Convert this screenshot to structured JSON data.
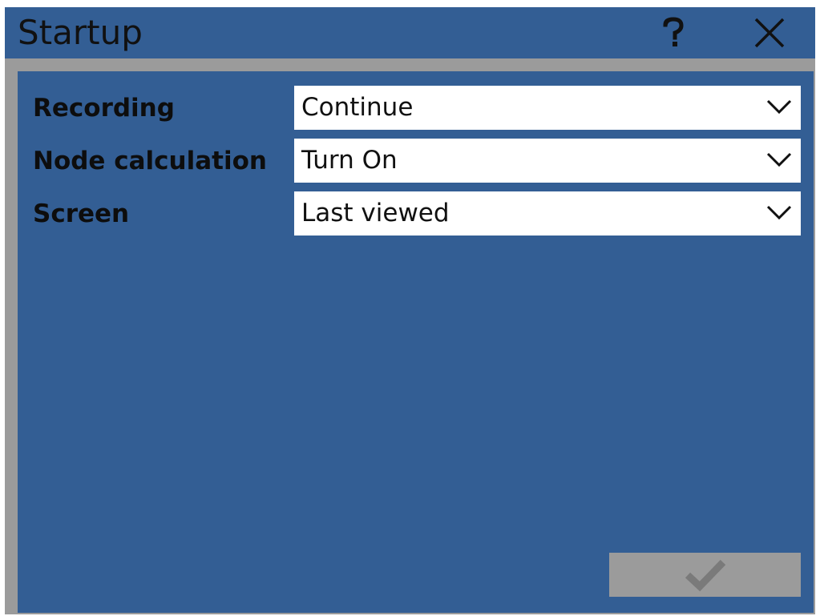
{
  "window": {
    "title": "Startup",
    "help_icon": "question-mark-icon",
    "close_icon": "close-x-icon"
  },
  "settings": [
    {
      "label": "Recording",
      "value": "Continue"
    },
    {
      "label": "Node calculation",
      "value": "Turn On"
    },
    {
      "label": "Screen",
      "value": "Last viewed"
    }
  ],
  "footer": {
    "confirm_icon": "checkmark-icon",
    "confirm_enabled": false
  },
  "colors": {
    "accent_blue": "#335e94",
    "frame_gray": "#9b9b9b",
    "disabled_check": "#7a7a7a"
  }
}
